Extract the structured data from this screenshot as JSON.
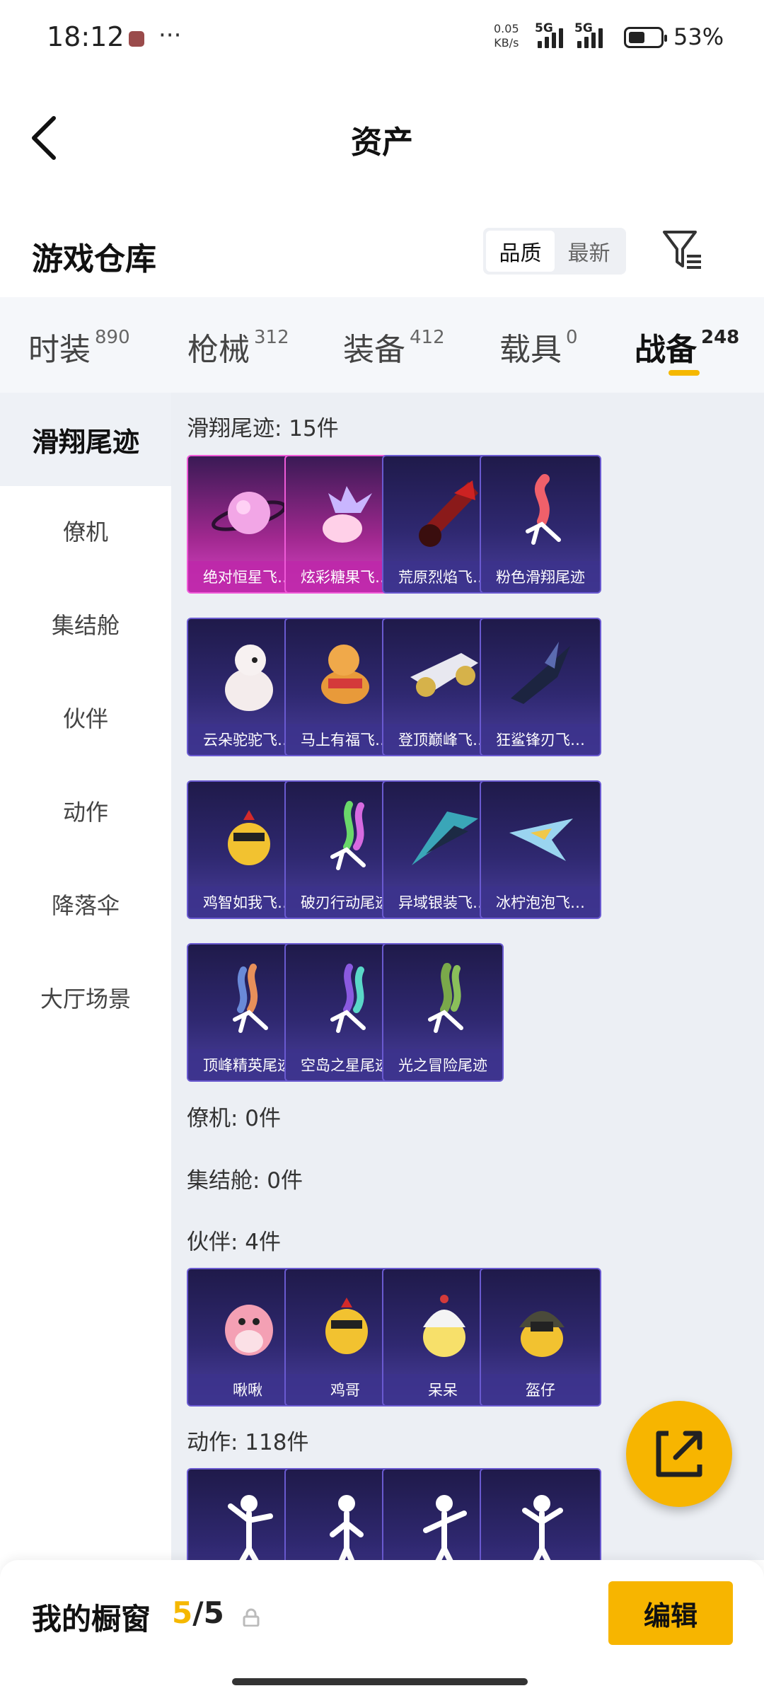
{
  "status": {
    "time": "18:12",
    "net_speed_top": "0.05",
    "net_speed_bottom": "KB/s",
    "sim1": "5G",
    "sim2": "5G",
    "battery": "53%",
    "battery_level": 0.53
  },
  "header": {
    "title": "资产"
  },
  "warehouse": {
    "title": "游戏仓库",
    "sort_options": [
      "品质",
      "最新"
    ],
    "sort_selected": "品质"
  },
  "tabs": [
    {
      "label": "时装",
      "count": "890"
    },
    {
      "label": "枪械",
      "count": "312"
    },
    {
      "label": "装备",
      "count": "412"
    },
    {
      "label": "载具",
      "count": "0"
    },
    {
      "label": "战备",
      "count": "248",
      "active": true
    }
  ],
  "sidebar": {
    "items": [
      "滑翔尾迹",
      "僚机",
      "集结舱",
      "伙伴",
      "动作",
      "降落伞",
      "大厅场景"
    ],
    "active": "滑翔尾迹"
  },
  "sections": {
    "trail": {
      "title": "滑翔尾迹: 15件",
      "items": [
        "绝对恒星飞…",
        "炫彩糖果飞…",
        "荒原烈焰飞…",
        "粉色滑翔尾迹",
        "云朵驼驼飞…",
        "马上有福飞…",
        "登顶巅峰飞…",
        "狂鲨锋刃飞…",
        "鸡智如我飞…",
        "破刃行动尾迹",
        "异域银装飞…",
        "冰柠泡泡飞…",
        "顶峰精英尾迹",
        "空岛之星尾迹",
        "光之冒险尾迹"
      ]
    },
    "wingman": {
      "title": "僚机: 0件"
    },
    "capsule": {
      "title": "集结舱: 0件"
    },
    "partner": {
      "title": "伙伴: 4件",
      "items": [
        "啾啾",
        "鸡哥",
        "呆呆",
        "盔仔"
      ]
    },
    "emote": {
      "title": "动作: 118件"
    }
  },
  "showcase": {
    "label": "我的橱窗",
    "current": "5",
    "sep": "/",
    "total": "5",
    "edit_label": "编辑"
  },
  "colors": {
    "accent": "#f7b500",
    "legend_card": "#c43bb3",
    "epic_card": "#3a2f86"
  }
}
